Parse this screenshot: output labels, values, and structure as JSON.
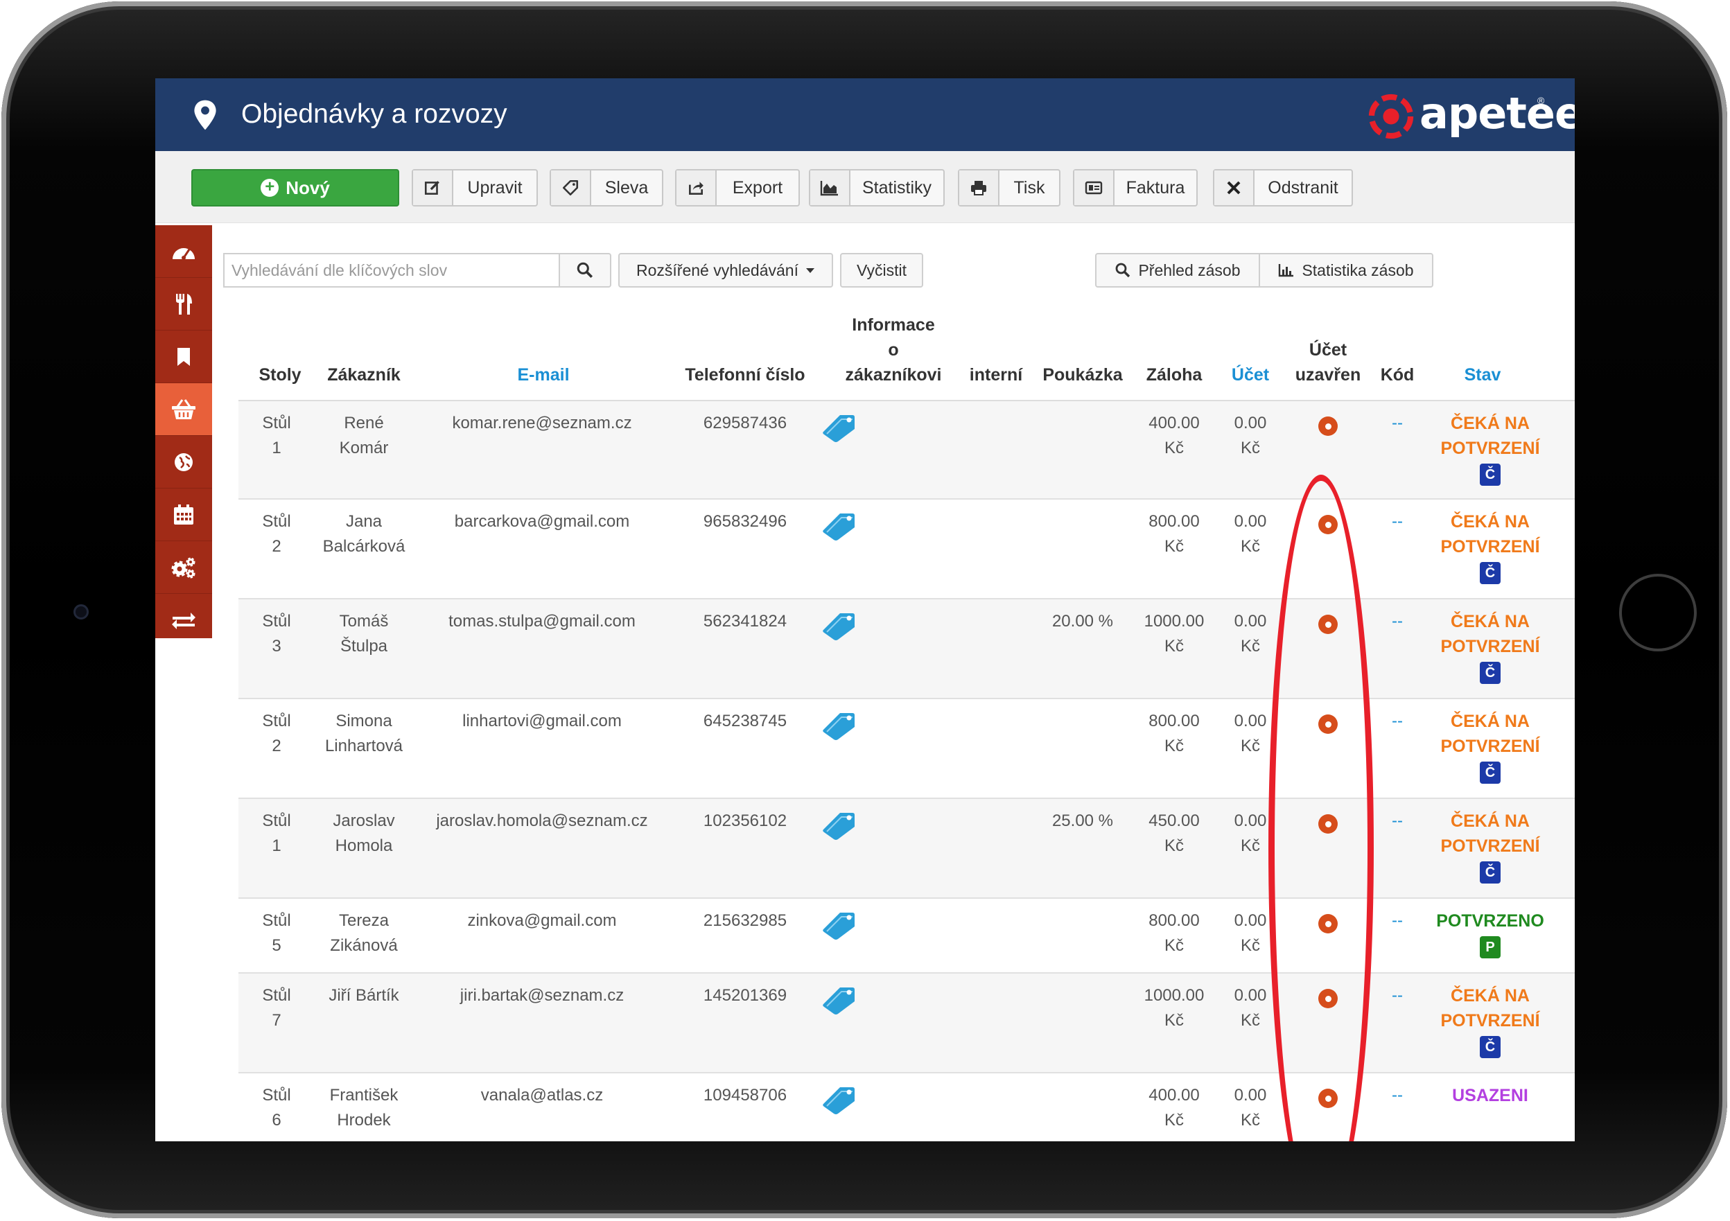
{
  "header": {
    "title": "Objednávky a rozvozy",
    "logo_text": "apetee",
    "logo_reg": "®"
  },
  "toolbar": {
    "new_label": "Nový",
    "edit_label": "Upravit",
    "discount_label": "Sleva",
    "export_label": "Export",
    "stats_label": "Statistiky",
    "print_label": "Tisk",
    "invoice_label": "Faktura",
    "delete_label": "Odstranit"
  },
  "search": {
    "placeholder": "Vyhledávání dle klíčových slov",
    "advanced_label": "Rozšířené vyhledávání",
    "clear_label": "Vyčistit",
    "stock_overview_label": "Přehled zásob",
    "stock_stats_label": "Statistika zásob"
  },
  "table": {
    "columns": {
      "tables": "Stoly",
      "customer": "Zákazník",
      "email": "E-mail",
      "phone": "Telefonní číslo",
      "info_line1": "Informace",
      "info_line2": "o",
      "info_line3": "zákazníkovi",
      "internal": "interní",
      "voucher": "Poukázka",
      "deposit": "Záloha",
      "bill": "Účet",
      "closed_line1": "Účet",
      "closed_line2": "uzavřen",
      "code": "Kód",
      "status": "Stav"
    },
    "rows": [
      {
        "table1": "Stůl",
        "table2": "1",
        "name1": "René",
        "name2": "Komár",
        "email": "komar.rene@seznam.cz",
        "phone": "629587436",
        "voucher": "",
        "deposit1": "400.00",
        "deposit2": "Kč",
        "bill1": "0.00",
        "bill2": "Kč",
        "code": "--",
        "status1": "ČEKÁ NA",
        "status2": "POTVRZENÍ",
        "badge": "Č"
      },
      {
        "table1": "Stůl",
        "table2": "2",
        "name1": "Jana",
        "name2": "Balcárková",
        "email": "barcarkova@gmail.com",
        "phone": "965832496",
        "voucher": "",
        "deposit1": "800.00",
        "deposit2": "Kč",
        "bill1": "0.00",
        "bill2": "Kč",
        "code": "--",
        "status1": "ČEKÁ NA",
        "status2": "POTVRZENÍ",
        "badge": "Č"
      },
      {
        "table1": "Stůl",
        "table2": "3",
        "name1": "Tomáš",
        "name2": "Štulpa",
        "email": "tomas.stulpa@gmail.com",
        "phone": "562341824",
        "voucher": "20.00 %",
        "deposit1": "1000.00",
        "deposit2": "Kč",
        "bill1": "0.00",
        "bill2": "Kč",
        "code": "--",
        "status1": "ČEKÁ NA",
        "status2": "POTVRZENÍ",
        "badge": "Č"
      },
      {
        "table1": "Stůl",
        "table2": "2",
        "name1": "Simona",
        "name2": "Linhartová",
        "email": "linhartovi@gmail.com",
        "phone": "645238745",
        "voucher": "",
        "deposit1": "800.00",
        "deposit2": "Kč",
        "bill1": "0.00",
        "bill2": "Kč",
        "code": "--",
        "status1": "ČEKÁ NA",
        "status2": "POTVRZENÍ",
        "badge": "Č"
      },
      {
        "table1": "Stůl",
        "table2": "1",
        "name1": "Jaroslav",
        "name2": "Homola",
        "email": "jaroslav.homola@seznam.cz",
        "phone": "102356102",
        "voucher": "25.00 %",
        "deposit1": "450.00",
        "deposit2": "Kč",
        "bill1": "0.00",
        "bill2": "Kč",
        "code": "--",
        "status1": "ČEKÁ NA",
        "status2": "POTVRZENÍ",
        "badge": "Č"
      },
      {
        "table1": "Stůl",
        "table2": "5",
        "name1": "Tereza",
        "name2": "Zikánová",
        "email": "zinkova@gmail.com",
        "phone": "215632985",
        "voucher": "",
        "deposit1": "800.00",
        "deposit2": "Kč",
        "bill1": "0.00",
        "bill2": "Kč",
        "code": "--",
        "status1": "POTVRZENO",
        "status2": "",
        "badge": "P"
      },
      {
        "table1": "Stůl",
        "table2": "7",
        "name1": "Jiří Bártík",
        "name2": "",
        "email": "jiri.bartak@seznam.cz",
        "phone": "145201369",
        "voucher": "",
        "deposit1": "1000.00",
        "deposit2": "Kč",
        "bill1": "0.00",
        "bill2": "Kč",
        "code": "--",
        "status1": "ČEKÁ NA",
        "status2": "POTVRZENÍ",
        "badge": "Č"
      },
      {
        "table1": "Stůl",
        "table2": "6",
        "name1": "František",
        "name2": "Hrodek",
        "email": "vanala@atlas.cz",
        "phone": "109458706",
        "voucher": "",
        "deposit1": "400.00",
        "deposit2": "Kč",
        "bill1": "0.00",
        "bill2": "Kč",
        "code": "--",
        "status1": "USAZENI",
        "status2": "",
        "badge": ""
      }
    ]
  },
  "colors": {
    "header_bg": "#213d6b",
    "sidebar_bg": "#a12b17",
    "sidebar_active": "#e8603a",
    "status_waiting": "#f07a1a",
    "status_confirmed": "#1f8a1f",
    "status_seated": "#b340e0",
    "badge_waiting": "#1c3aa8",
    "badge_confirmed": "#1f8a1f",
    "link": "#1a8fd4",
    "annotation": "#e8202a"
  },
  "icons": {
    "sidebar": [
      "dashboard-icon",
      "utensils-icon",
      "bookmark-icon",
      "basket-icon",
      "globe-icon",
      "calendar-icon",
      "gears-icon",
      "exchange-icon"
    ],
    "row_info": "tag-icon",
    "row_closed": "circle-dot-icon"
  }
}
